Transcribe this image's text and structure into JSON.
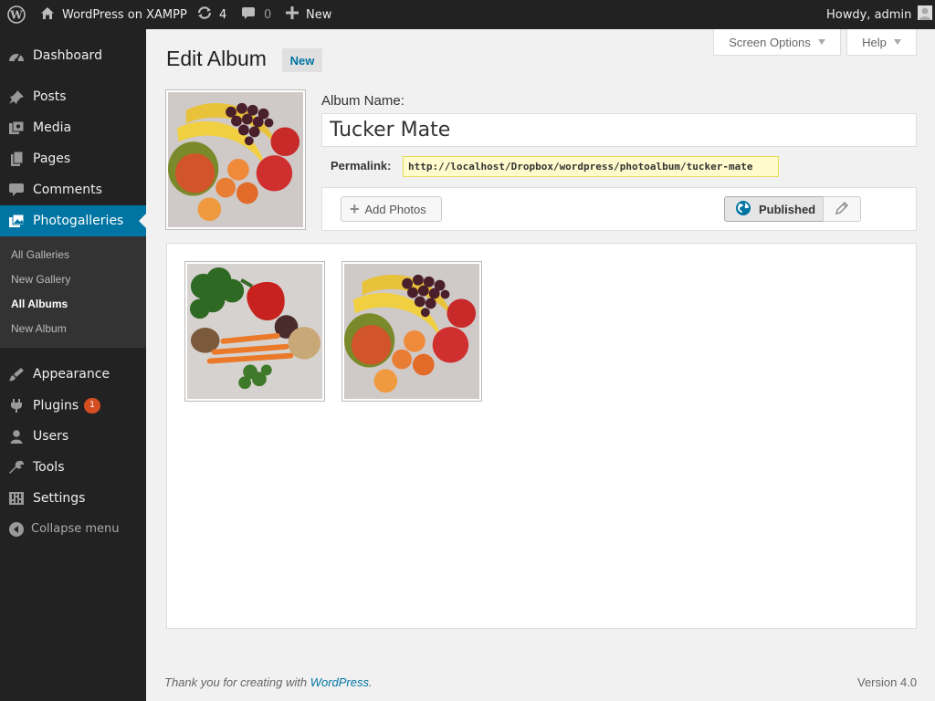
{
  "adminbar": {
    "site_name": "WordPress on XAMPP",
    "updates_count": "4",
    "comments_count": "0",
    "new_label": "New",
    "greeting": "Howdy, admin"
  },
  "sidebar": {
    "items": [
      {
        "label": "Dashboard",
        "icon": "dashboard-icon"
      },
      {
        "label": "Posts",
        "icon": "pin-icon"
      },
      {
        "label": "Media",
        "icon": "media-icon"
      },
      {
        "label": "Pages",
        "icon": "pages-icon"
      },
      {
        "label": "Comments",
        "icon": "comment-icon"
      },
      {
        "label": "Photogalleries",
        "icon": "gallery-icon"
      },
      {
        "label": "Appearance",
        "icon": "brush-icon"
      },
      {
        "label": "Plugins",
        "icon": "plug-icon",
        "badge": "1"
      },
      {
        "label": "Users",
        "icon": "user-icon"
      },
      {
        "label": "Tools",
        "icon": "wrench-icon"
      },
      {
        "label": "Settings",
        "icon": "settings-icon"
      }
    ],
    "submenu": [
      "All Galleries",
      "New Gallery",
      "All Albums",
      "New Album"
    ],
    "collapse_label": "Collapse menu"
  },
  "screen_options": {
    "screen_options_label": "Screen Options",
    "help_label": "Help"
  },
  "page": {
    "title": "Edit Album",
    "new_label": "New"
  },
  "album": {
    "name_label": "Album Name:",
    "name_value": "Tucker Mate",
    "permalink_label": "Permalink:",
    "permalink_url": "http://localhost/Dropbox/wordpress/photoalbum/tucker-mate"
  },
  "actions": {
    "add_photos_label": "Add Photos",
    "published_label": "Published"
  },
  "footer": {
    "thanks_prefix": "Thank you for creating with ",
    "thanks_link": "WordPress",
    "thanks_suffix": ".",
    "version": "Version 4.0"
  },
  "colors": {
    "adminbar_bg": "#222222",
    "sidebar_bg": "#222222",
    "current_menu_bg": "#0074a2",
    "permalink_bg": "#fffbcc",
    "badge_bg": "#d54e21"
  }
}
